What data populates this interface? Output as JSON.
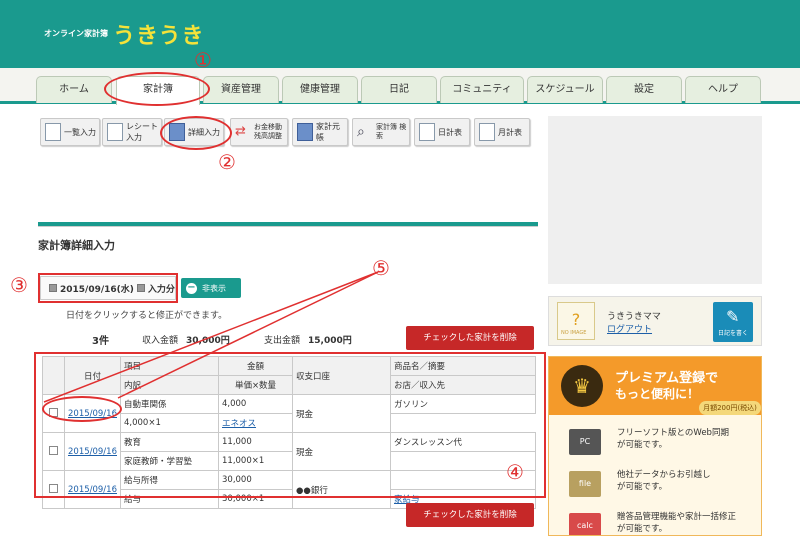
{
  "header": {
    "logo_small": "オンライン家計簿",
    "logo_big": "うきうき"
  },
  "tabs": [
    "ホーム",
    "家計簿",
    "資産管理",
    "健康管理",
    "日記",
    "コミュニティ",
    "スケジュール",
    "設定",
    "ヘルプ"
  ],
  "toolbar": [
    "一覧入力",
    "レシート入力",
    "詳細入力",
    "お金移動 残高調整",
    "家計元帳",
    "家計簿 検索",
    "日計表",
    "月計表"
  ],
  "page_title": "家計簿詳細入力",
  "filter": {
    "date": "2015/09/16(水)",
    "input": "入力分",
    "hide_label": "非表示"
  },
  "hint": "日付をクリックすると修正ができます。",
  "summary": {
    "count": "3件",
    "income_label": "収入金額",
    "income": "30,000円",
    "expense_label": "支出金額",
    "expense": "15,000円"
  },
  "delete_label": "チェックした家計を削除",
  "table": {
    "headers": {
      "date": "日付",
      "item": "項目",
      "detail": "内訳",
      "amount": "金額",
      "unit": "単価×数量",
      "account": "収支口座",
      "product": "商品名／摘要",
      "shop": "お店／収入先"
    },
    "rows": [
      {
        "date": "2015/09/16",
        "item": "自動車関係",
        "detail": "",
        "amount": "4,000",
        "unit": "4,000×1",
        "account": "現金",
        "product": "ガソリン",
        "shop": "エネオス"
      },
      {
        "date": "2015/09/16",
        "item": "教育",
        "detail": "家庭教師・学習塾",
        "amount": "11,000",
        "unit": "11,000×1",
        "account": "現金",
        "product": "ダンスレッスン代",
        "shop": ""
      },
      {
        "date": "2015/09/16",
        "item": "給与所得",
        "detail": "給与",
        "amount": "30,000",
        "unit": "30,000×1",
        "account": "●●銀行",
        "product": "",
        "shop": "家給与"
      }
    ]
  },
  "user": {
    "name": "うきうきママ",
    "logout": "ログアウト",
    "avatar_text": "NO IMAGE",
    "diary": "日記を書く"
  },
  "premium": {
    "line1": "プレミアム登録で",
    "line2": "もっと便利に！",
    "price": "月額200円(税込)",
    "features": [
      {
        "icon": "PC",
        "text1": "フリーソフト版とのWeb同期",
        "text2": "が可能です。"
      },
      {
        "icon": "file",
        "text1": "他社データからお引越し",
        "text2": "が可能です。"
      },
      {
        "icon": "calc",
        "text1": "贈答品管理機能や家計一括修正",
        "text2": "が可能です。"
      }
    ]
  },
  "annotations": [
    "①",
    "②",
    "③",
    "④",
    "⑤"
  ],
  "colors": {
    "brand": "#1a9a8e",
    "accent_yellow": "#f4e23a",
    "delete_red": "#c62828",
    "annotation_red": "#e03030"
  }
}
